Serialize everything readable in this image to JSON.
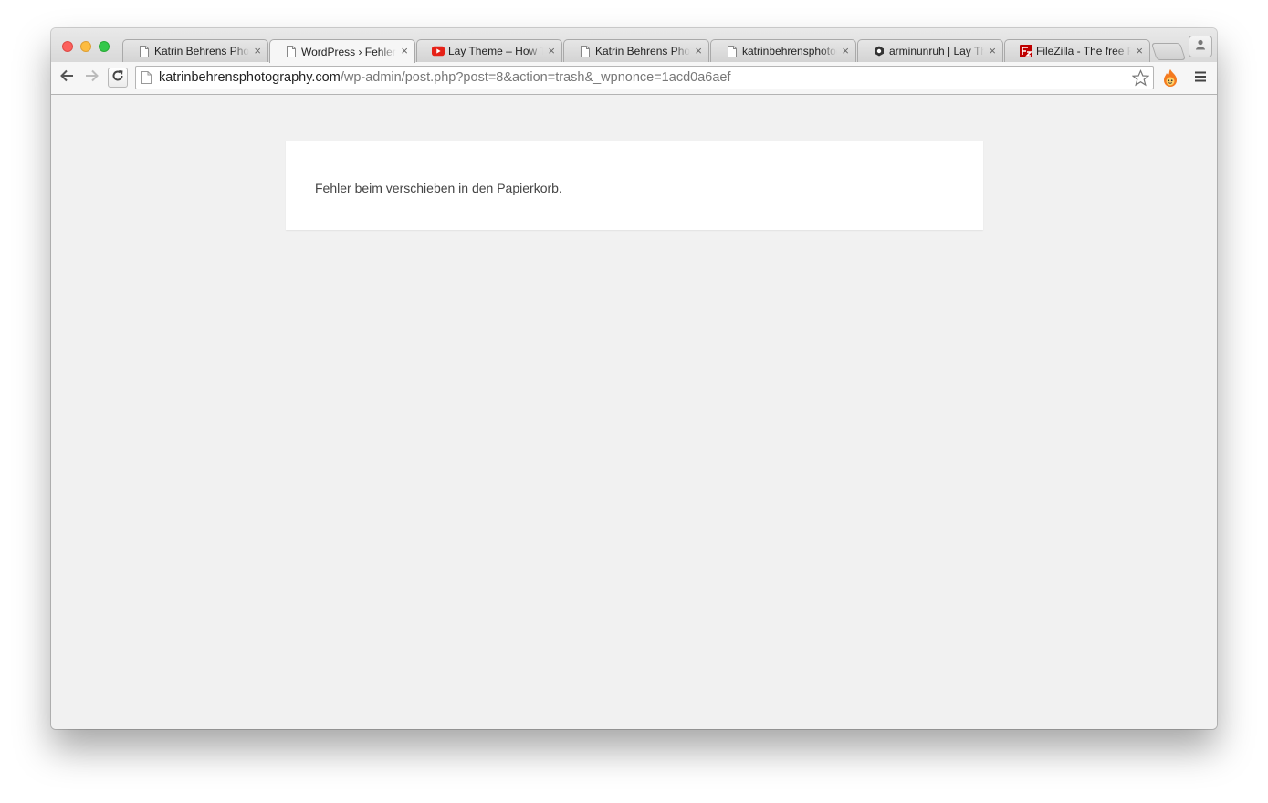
{
  "browser": {
    "tabs": [
      {
        "title": "Katrin Behrens Photo",
        "favicon": "page-icon",
        "active": false
      },
      {
        "title": "WordPress › Fehler",
        "favicon": "page-icon",
        "active": true
      },
      {
        "title": "Lay Theme – How To",
        "favicon": "youtube-icon",
        "active": false
      },
      {
        "title": "Katrin Behrens Photo",
        "favicon": "page-icon",
        "active": false
      },
      {
        "title": "katrinbehrensphotog",
        "favicon": "page-icon",
        "active": false
      },
      {
        "title": "arminunruh | Lay The",
        "favicon": "github-icon",
        "active": false
      },
      {
        "title": "FileZilla - The free FT",
        "favicon": "filezilla-icon",
        "active": false
      }
    ],
    "tab_close_glyph": "×",
    "address": {
      "host": "katrinbehrensphotography.com",
      "path": "/wp-admin/post.php?post=8&action=trash&_wpnonce=1acd0a6aef"
    }
  },
  "page": {
    "error_message": "Fehler beim verschieben in den Papierkorb."
  },
  "colors": {
    "page_background": "#f1f1f1",
    "box_background": "#ffffff",
    "message_text": "#444444",
    "youtube_red": "#e62117",
    "filezilla_red": "#bf0000"
  }
}
